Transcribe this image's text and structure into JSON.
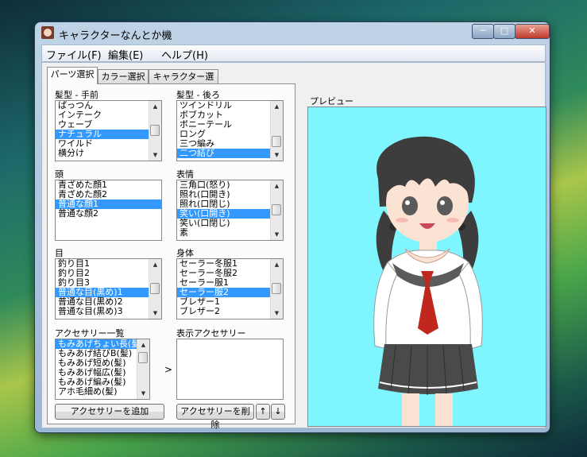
{
  "window": {
    "title": "キャラクターなんとか機",
    "min_symbol": "─",
    "max_symbol": "□",
    "close_symbol": "✕"
  },
  "menu": [
    "ファイル(F)",
    "編集(E)",
    "ヘルプ(H)"
  ],
  "tabs": [
    {
      "label": "パーツ選択",
      "active": true
    },
    {
      "label": "カラー選択",
      "active": false
    },
    {
      "label": "キャラクター選択",
      "active": false
    }
  ],
  "hair_front": {
    "label": "髪型 - 手前",
    "items": [
      "ぱっつん",
      "インテーク",
      "ウェーブ",
      "ナチュラル",
      "ワイルド",
      "横分け"
    ],
    "selected": 3
  },
  "hair_back": {
    "label": "髪型 - 後ろ",
    "items": [
      "ツインドリル",
      "ボブカット",
      "ポニーテール",
      "ロング",
      "三つ編み",
      "二つ結び"
    ],
    "selected": 5
  },
  "head": {
    "label": "頭",
    "items": [
      "青ざめた顔1",
      "青ざめた顔2",
      "普通な顔1",
      "普通な顔2"
    ],
    "selected": 2
  },
  "expression": {
    "label": "表情",
    "items": [
      "三角口(怒り)",
      "照れ(口開き)",
      "照れ(口閉じ)",
      "笑い(口開き)",
      "笑い(口閉じ)",
      "素"
    ],
    "selected": 3
  },
  "eyes": {
    "label": "目",
    "items": [
      "釣り目1",
      "釣り目2",
      "釣り目3",
      "普通な目(黒め)1",
      "普通な目(黒め)2",
      "普通な目(黒め)3"
    ],
    "selected": 3
  },
  "body": {
    "label": "身体",
    "items": [
      "セーラー冬服1",
      "セーラー冬服2",
      "セーラー服1",
      "セーラー服2",
      "ブレザー1",
      "ブレザー2"
    ],
    "selected": 3
  },
  "accessories": {
    "label": "アクセサリー一覧",
    "items": [
      "もみあげちょい長(髪)",
      "もみあげ結びB(髪)",
      "もみあげ短め(髪)",
      "もみあげ幅広(髪)",
      "もみあげ編み(髪)",
      "アホ毛細め(髪)"
    ],
    "selected": 0
  },
  "shown_accessories": {
    "label": "表示アクセサリー",
    "items": []
  },
  "transfer_symbol": ">",
  "buttons": {
    "add": "アクセサリーを追加",
    "remove": "アクセサリーを削除",
    "up": "↑",
    "down": "↓"
  },
  "preview": {
    "label": "プレビュー",
    "background": "#7ff6ff"
  },
  "colors": {
    "selection": "#3399ff",
    "hair": "#3d3d3d",
    "skin": "#fbe3d3",
    "uniform": "#ffffff",
    "tie": "#c0281e",
    "skirt": "#4a4a4a"
  }
}
